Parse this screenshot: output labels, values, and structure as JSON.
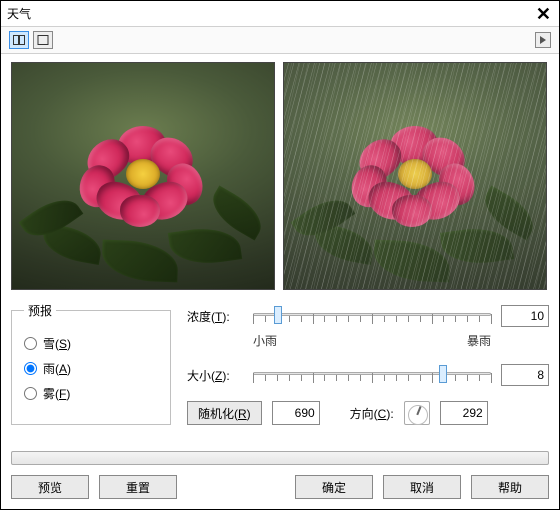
{
  "title": "天气",
  "toolbar": {
    "side_by_side_active": true
  },
  "forecast": {
    "legend": "预报",
    "options": [
      {
        "label": "雪(S)",
        "value": "snow",
        "checked": false,
        "accel": "S"
      },
      {
        "label": "雨(A)",
        "value": "rain",
        "checked": true,
        "accel": "A"
      },
      {
        "label": "雾(F)",
        "value": "fog",
        "checked": false,
        "accel": "F"
      }
    ]
  },
  "intensity": {
    "label": "浓度(T):",
    "value": 10,
    "min": 0,
    "max": 100,
    "low_label": "小雨",
    "high_label": "暴雨",
    "accel": "T"
  },
  "size": {
    "label": "大小(Z):",
    "value": 8,
    "min": 0,
    "max": 10,
    "accel": "Z"
  },
  "randomize": {
    "button": "随机化(R)",
    "seed": 690,
    "accel": "R"
  },
  "direction": {
    "label": "方向(C):",
    "value": 292,
    "accel": "C"
  },
  "buttons": {
    "preview": "预览",
    "reset": "重置",
    "ok": "确定",
    "cancel": "取消",
    "help": "帮助"
  }
}
